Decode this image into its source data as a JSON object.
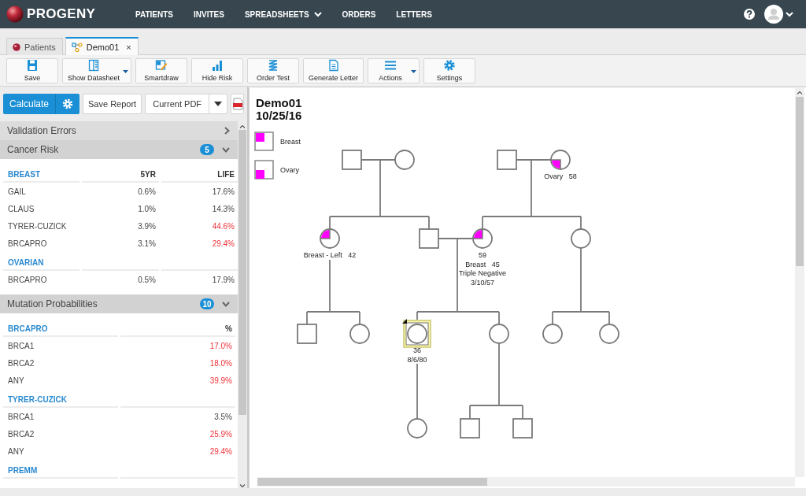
{
  "app": {
    "logo": "PROGENY"
  },
  "nav": [
    {
      "label": "PATIENTS",
      "dropdown": false
    },
    {
      "label": "INVITES",
      "dropdown": false
    },
    {
      "label": "SPREADSHEETS",
      "dropdown": true
    },
    {
      "label": "ORDERS",
      "dropdown": false
    },
    {
      "label": "LETTERS",
      "dropdown": false
    }
  ],
  "tabs": [
    {
      "label": "Patients",
      "selected": false,
      "closable": false
    },
    {
      "label": "Demo01",
      "selected": true,
      "closable": true,
      "close": "×"
    }
  ],
  "toolbar": [
    {
      "label": "Save",
      "dropdown": false
    },
    {
      "label": "Show Datasheet",
      "dropdown": true
    },
    {
      "label": "Smartdraw",
      "dropdown": false
    },
    {
      "label": "Hide Risk",
      "dropdown": false
    },
    {
      "label": "Order Test",
      "dropdown": false
    },
    {
      "label": "Generate Letter",
      "dropdown": false
    },
    {
      "label": "Actions",
      "dropdown": true
    },
    {
      "label": "Settings",
      "dropdown": false
    }
  ],
  "actions": {
    "calculate": "Calculate",
    "save_report": "Save Report",
    "pdf_select": "Current PDF"
  },
  "sections": [
    {
      "title": "Validation Errors",
      "expanded": false
    },
    {
      "title": "Cancer Risk",
      "expanded": true,
      "badge": "5",
      "groups": [
        {
          "title": "BREAST",
          "columns": [
            "5YR",
            "LIFE"
          ],
          "rows": [
            {
              "name": "GAIL",
              "values": [
                {
                  "text": "0.6%",
                  "elevated": false
                },
                {
                  "text": "17.6%",
                  "elevated": false
                }
              ]
            },
            {
              "name": "CLAUS",
              "values": [
                {
                  "text": "1.0%",
                  "elevated": false
                },
                {
                  "text": "14.3%",
                  "elevated": false
                }
              ]
            },
            {
              "name": "TYRER-CUZICK",
              "values": [
                {
                  "text": "3.9%",
                  "elevated": false
                },
                {
                  "text": "44.6%",
                  "elevated": true
                }
              ]
            },
            {
              "name": "BRCAPRO",
              "values": [
                {
                  "text": "3.1%",
                  "elevated": false
                },
                {
                  "text": "29.4%",
                  "elevated": true
                }
              ]
            }
          ]
        },
        {
          "title": "OVARIAN",
          "rows": [
            {
              "name": "BRCAPRO",
              "values": [
                {
                  "text": "0.5%",
                  "elevated": false
                },
                {
                  "text": "17.9%",
                  "elevated": false
                }
              ]
            }
          ]
        }
      ]
    },
    {
      "title": "Mutation Probabilities",
      "expanded": true,
      "badge": "10",
      "groups": [
        {
          "title": "BRCAPRO",
          "columns": [
            "%"
          ],
          "rows": [
            {
              "name": "BRCA1",
              "values": [
                {
                  "text": "17.0%",
                  "elevated": true
                }
              ]
            },
            {
              "name": "BRCA2",
              "values": [
                {
                  "text": "18.0%",
                  "elevated": true
                }
              ]
            },
            {
              "name": "ANY",
              "values": [
                {
                  "text": "39.9%",
                  "elevated": true
                }
              ]
            }
          ]
        },
        {
          "title": "TYRER-CUZICK",
          "rows": [
            {
              "name": "BRCA1",
              "values": [
                {
                  "text": "3.5%",
                  "elevated": false
                }
              ]
            },
            {
              "name": "BRCA2",
              "values": [
                {
                  "text": "25.9%",
                  "elevated": true
                }
              ]
            },
            {
              "name": "ANY",
              "values": [
                {
                  "text": "29.4%",
                  "elevated": true
                }
              ]
            }
          ]
        },
        {
          "title": "PREMM"
        }
      ]
    }
  ],
  "pedigree": {
    "title": "Demo01",
    "date": "10/25/16",
    "legend": [
      {
        "label": "Breast",
        "kind": "breast"
      },
      {
        "label": "Ovary",
        "kind": "ovary"
      }
    ],
    "nodes": [
      {
        "kind": "male",
        "breast_cancer": false,
        "ovarian_cancer": false,
        "proband": false
      },
      {
        "kind": "female",
        "breast_cancer": false,
        "ovarian_cancer": false,
        "proband": false
      },
      {
        "kind": "male",
        "breast_cancer": false,
        "ovarian_cancer": false,
        "proband": false
      },
      {
        "kind": "female",
        "breast_cancer": false,
        "ovarian_cancer": true,
        "proband": false,
        "labels": [
          "Ovary   58"
        ]
      },
      {
        "kind": "female",
        "breast_cancer": true,
        "ovarian_cancer": false,
        "proband": false,
        "labels": [
          "Breast - Left   42"
        ]
      },
      {
        "kind": "male",
        "breast_cancer": false,
        "ovarian_cancer": false,
        "proband": false
      },
      {
        "kind": "female",
        "breast_cancer": true,
        "ovarian_cancer": false,
        "proband": false,
        "labels": [
          "59",
          "Breast   45",
          "Triple Negative",
          "3/10/57"
        ]
      },
      {
        "kind": "female",
        "breast_cancer": false,
        "ovarian_cancer": false,
        "proband": false
      },
      {
        "kind": "male",
        "breast_cancer": false,
        "ovarian_cancer": false,
        "proband": false
      },
      {
        "kind": "female",
        "breast_cancer": false,
        "ovarian_cancer": false,
        "proband": false
      },
      {
        "kind": "female",
        "breast_cancer": false,
        "ovarian_cancer": false,
        "proband": true,
        "labels": [
          "36",
          "8/6/80"
        ]
      },
      {
        "kind": "female",
        "breast_cancer": false,
        "ovarian_cancer": false,
        "proband": false
      },
      {
        "kind": "female",
        "breast_cancer": false,
        "ovarian_cancer": false,
        "proband": false
      },
      {
        "kind": "female",
        "breast_cancer": false,
        "ovarian_cancer": false,
        "proband": false
      },
      {
        "kind": "female",
        "breast_cancer": false,
        "ovarian_cancer": false,
        "proband": false
      },
      {
        "kind": "male",
        "breast_cancer": false,
        "ovarian_cancer": false,
        "proband": false
      },
      {
        "kind": "male",
        "breast_cancer": false,
        "ovarian_cancer": false,
        "proband": false
      }
    ]
  }
}
